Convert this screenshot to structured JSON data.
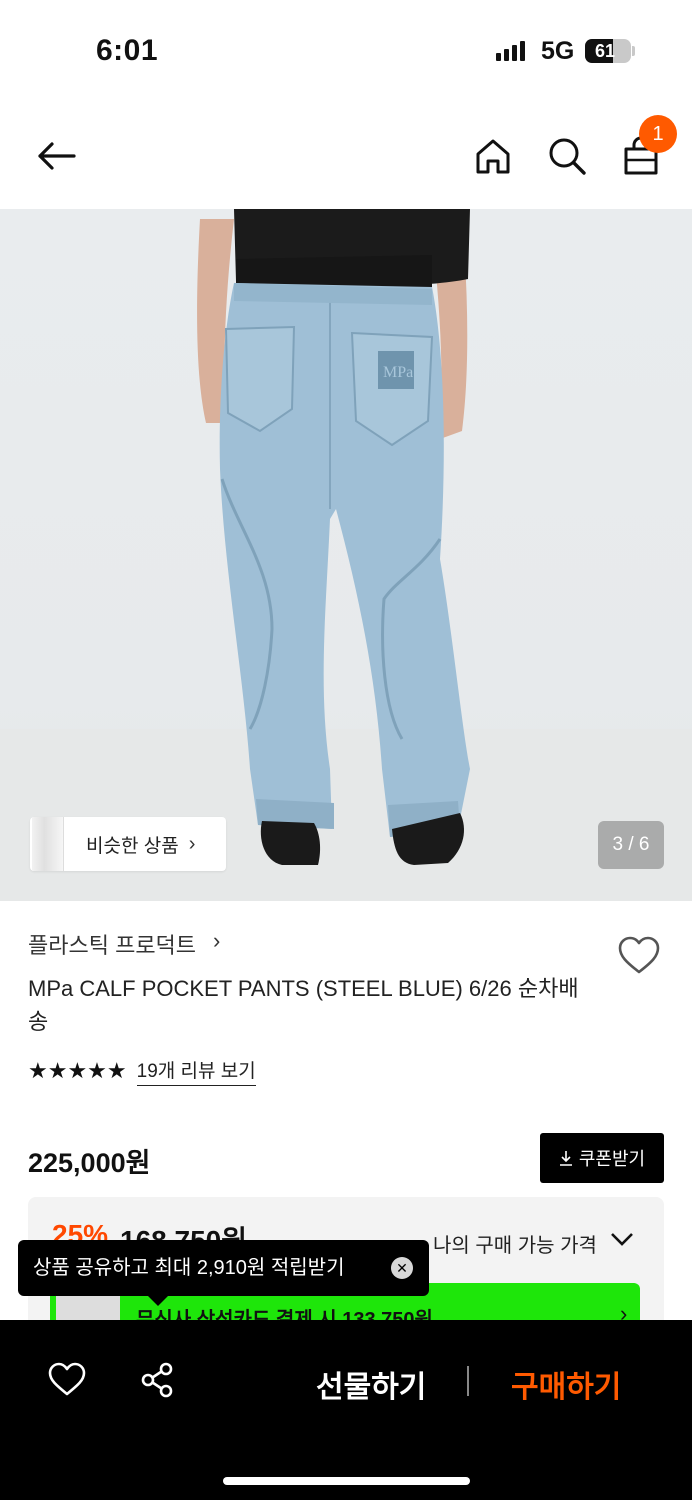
{
  "status_bar": {
    "time": "6:01",
    "network": "5G",
    "battery": "61",
    "battery_level": 0.61
  },
  "nav": {
    "back_icon": "arrow-left-icon",
    "home_icon": "home-icon",
    "search_icon": "search-icon",
    "cart_icon": "shopping-bag-icon",
    "cart_count": "1"
  },
  "hero": {
    "similar_label": "비슷한 상품",
    "similar_chevron": "›",
    "page_indicator": "3 / 6",
    "image_alt": "back view of light blue denim pants"
  },
  "product": {
    "brand": "플라스틱 프로덕트",
    "brand_chevron": "›",
    "title": "MPa CALF POCKET PANTS (STEEL BLUE) 6/26 순차배송",
    "stars": "★★★★★",
    "review_link": "19개 리뷰 보기",
    "price": "225,000원",
    "coupon_label": "쿠폰받기",
    "discount_rate": "25%",
    "discount_price": "168,750원",
    "available_price_label": "나의 구매 가능 가격",
    "card_banner_text": "무신사 삼성카드 결제 시 133,750원"
  },
  "tooltip": {
    "text": "상품 공유하고 최대 2,910원 적립받기",
    "close_label": "✕"
  },
  "bottom_bar": {
    "gift_label": "선물하기",
    "buy_label": "구매하기"
  },
  "colors": {
    "accent": "#ff5a00",
    "discount": "#ff4800",
    "card_banner": "#1ee60a",
    "bar_bg": "#000000"
  }
}
